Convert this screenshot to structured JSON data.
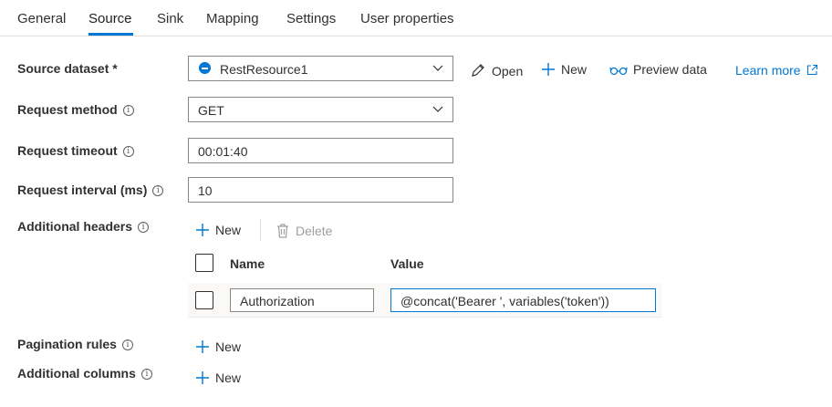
{
  "tabs": [
    {
      "label": "General"
    },
    {
      "label": "Source"
    },
    {
      "label": "Sink"
    },
    {
      "label": "Mapping"
    },
    {
      "label": "Settings"
    },
    {
      "label": "User properties"
    }
  ],
  "active_tab": "Source",
  "source_dataset": {
    "label": "Source dataset *",
    "value": "RestResource1",
    "open_label": "Open",
    "new_label": "New",
    "preview_label": "Preview data",
    "learn_more_label": "Learn more"
  },
  "request_method": {
    "label": "Request method",
    "value": "GET"
  },
  "request_timeout": {
    "label": "Request timeout",
    "value": "00:01:40"
  },
  "request_interval": {
    "label": "Request interval (ms)",
    "value": "10"
  },
  "additional_headers": {
    "label": "Additional headers",
    "new_label": "New",
    "delete_label": "Delete",
    "columns": {
      "name": "Name",
      "value": "Value"
    },
    "rows": [
      {
        "name": "Authorization",
        "value": "@concat('Bearer ', variables('token'))"
      }
    ]
  },
  "pagination_rules": {
    "label": "Pagination rules",
    "new_label": "New"
  },
  "additional_columns": {
    "label": "Additional columns",
    "new_label": "New"
  },
  "colors": {
    "accent": "#0078d4",
    "text": "#323130",
    "border": "#8a8886"
  }
}
